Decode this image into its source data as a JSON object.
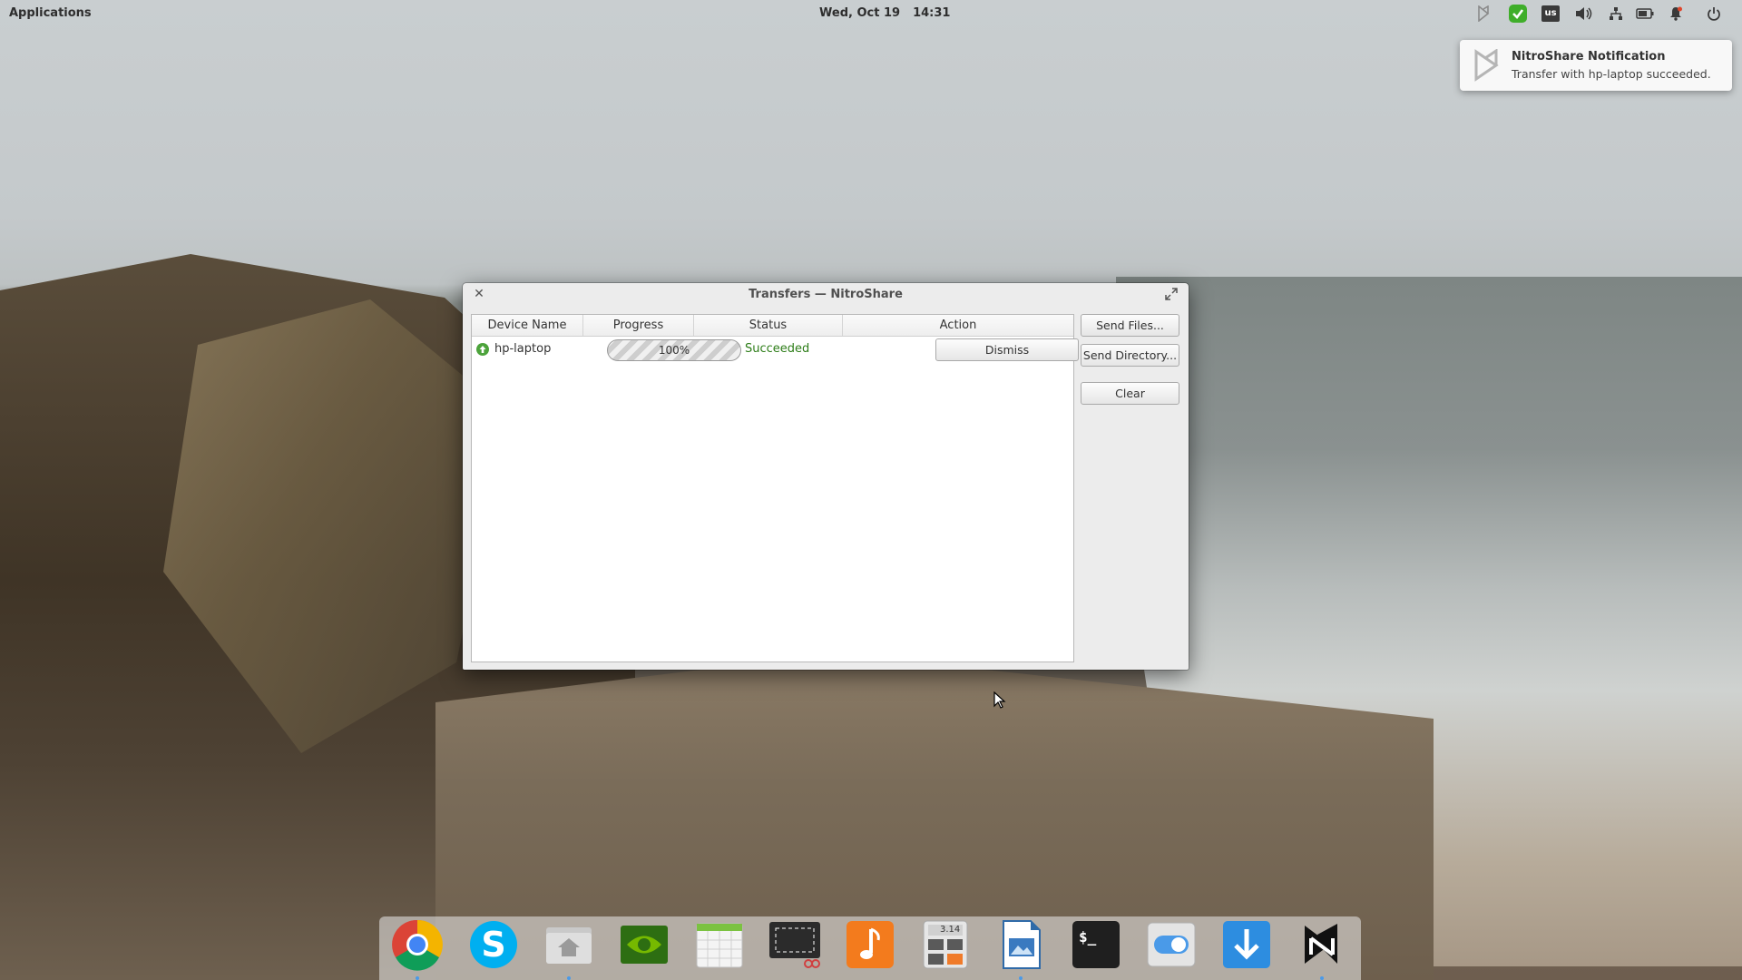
{
  "top_panel": {
    "applications_label": "Applications",
    "date": "Wed, Oct 19",
    "time": "14:31",
    "keyboard_layout": "us",
    "indicator_icons": [
      "nitroshare-tray-icon",
      "security-check-icon",
      "keyboard-layout-icon",
      "volume-icon",
      "network-icon",
      "battery-icon",
      "notifications-bell-icon",
      "power-icon"
    ]
  },
  "notification": {
    "title": "NitroShare Notification",
    "body": "Transfer with hp-laptop succeeded."
  },
  "window": {
    "title": "Transfers — NitroShare",
    "columns": [
      "Device Name",
      "Progress",
      "Status",
      "Action"
    ],
    "transfers": [
      {
        "device": "hp-laptop",
        "progress_text": "100%",
        "progress_percent": 100,
        "status": "Succeeded",
        "action": "Dismiss"
      }
    ],
    "buttons": {
      "send_files": "Send Files...",
      "send_directory": "Send Directory...",
      "clear": "Clear"
    }
  },
  "dock": {
    "apps": [
      "chrome",
      "skype",
      "files-home",
      "nvidia-settings",
      "calendar",
      "screenshot",
      "music",
      "calculator",
      "libreoffice-impress",
      "terminal",
      "system-settings",
      "downloads",
      "nitroshare"
    ],
    "calculator_display": "3.14"
  },
  "colors": {
    "status_success": "#2d7d18",
    "accent_blue": "#4a9ae8",
    "nitroshare_green": "#4ca33b"
  }
}
